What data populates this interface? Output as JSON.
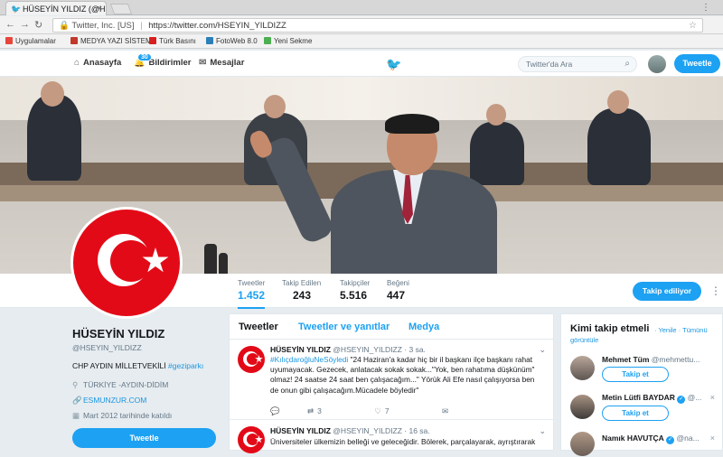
{
  "browser": {
    "tab_title": "HÜSEYİN YILDIZ (@HSEYİN",
    "tab_close": "×",
    "site_label": "Twitter, Inc. [US]",
    "url": "https://twitter.com/HSEYIN_YILDIZZ",
    "bookmarks": [
      {
        "label": "Uygulamalar",
        "color": "#e8453c"
      },
      {
        "label": "MEDYA YAZI SİSTEMİ",
        "color": "#c0392b"
      },
      {
        "label": "Türk Basını",
        "color": "#d81e1e"
      },
      {
        "label": "FotoWeb 8.0",
        "color": "#2c7fb8"
      },
      {
        "label": "Yeni Sekme",
        "color": "#4caf50"
      }
    ]
  },
  "nav": {
    "home": "Anasayfa",
    "notifications": "Bildirimler",
    "notif_count": "30",
    "messages": "Mesajlar",
    "search_placeholder": "Twitter'da Ara",
    "tweet_button": "Tweetle"
  },
  "stats": [
    {
      "label": "Tweetler",
      "value": "1.452"
    },
    {
      "label": "Takip Edilen",
      "value": "243"
    },
    {
      "label": "Takipçiler",
      "value": "5.516"
    },
    {
      "label": "Beğeni",
      "value": "447"
    }
  ],
  "follow_button": "Takip ediliyor",
  "profile": {
    "name": "HÜSEYİN YILDIZ",
    "handle": "@HSEYIN_YILDIZZ",
    "bio": "CHP AYDIN MİLLETVEKİLİ ",
    "bio_hashtag": "#geziparkı",
    "location": "TÜRKİYE -AYDIN-DİDİM",
    "website": "ESMUNZUR.COM",
    "joined": "Mart 2012 tarihinde katıldı",
    "tweet_button": "Tweetle"
  },
  "timeline": {
    "tabs": [
      "Tweetler",
      "Tweetler ve yanıtlar",
      "Medya"
    ],
    "tweets": [
      {
        "name": "HÜSEYİN YILDIZ",
        "meta": "@HSEYIN_YILDIZZ · 3 sa.",
        "hashtag": "#KılıçdaroğluNeSöyledi",
        "text": " \"24 Haziran'a kadar hiç bir il başkanı ilçe başkanı rahat uyumayacak. Gezecek, anlatacak sokak sokak...\"Yok, ben rahatıma düşkünüm\" olmaz! 24 saatse 24 saat ben çalışacağım...\" Yörük Ali Efe nasıl çalışıyorsa ben de onun gibi çalışacağım.Mücadele böyledir\"",
        "replies": "",
        "retweets": "3",
        "likes": "7"
      },
      {
        "name": "HÜSEYİN YILDIZ",
        "meta": "@HSEYIN_YILDIZZ · 16 sa.",
        "text": "Üniversiteler ülkemizin belleği ve geleceğidir. Bölerek, parçalayarak, ayrıştırarak"
      }
    ]
  },
  "who_to_follow": {
    "title": "Kimi takip etmeli",
    "refresh": "· Yenile · Tümünü",
    "view_all": "görüntüle",
    "follow_label": "Takip et",
    "users": [
      {
        "name": "Mehmet Tüm",
        "handle": "@mehmettu...",
        "verified": false
      },
      {
        "name": "Metin Lütfi BAYDAR",
        "handle": "@...",
        "verified": true
      },
      {
        "name": "Namık HAVUTÇA",
        "handle": "@na...",
        "verified": true
      }
    ]
  },
  "colors": {
    "accent": "#1da1f2",
    "flag_red": "#e30a17"
  }
}
